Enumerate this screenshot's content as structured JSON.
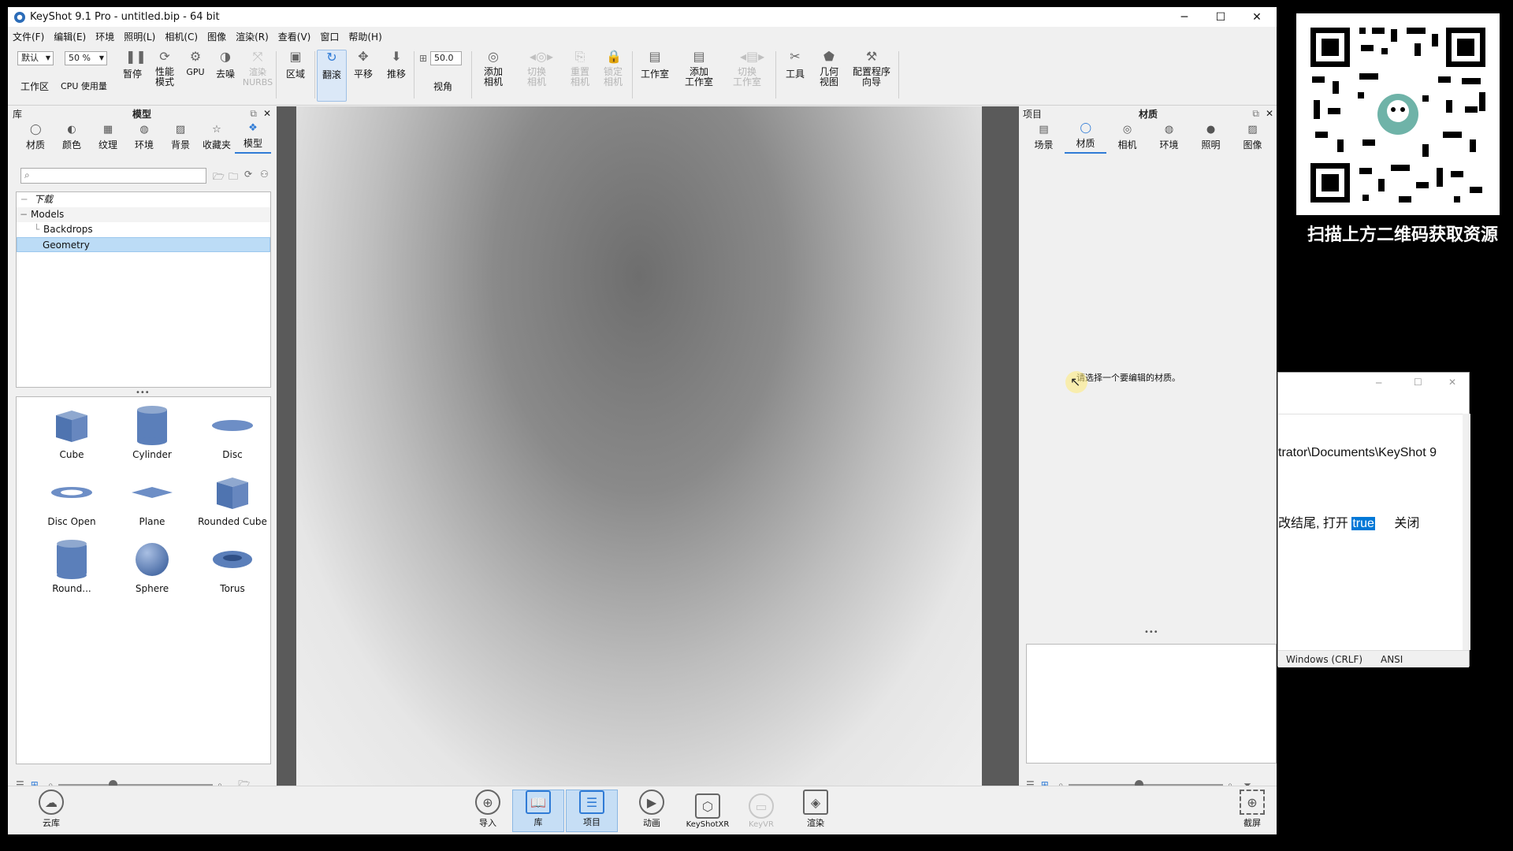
{
  "window": {
    "title": "KeyShot 9.1 Pro  - untitled.bip  - 64 bit",
    "minimize": "─",
    "maximize": "☐",
    "close": "✕"
  },
  "menu": [
    "文件(F)",
    "编辑(E)",
    "环境",
    "照明(L)",
    "相机(C)",
    "图像",
    "渲染(R)",
    "查看(V)",
    "窗口",
    "帮助(H)"
  ],
  "toolbar": {
    "workspace_select": "默认",
    "workspace_label": "工作区",
    "cpu_percent": "50 %",
    "cpu_label": "CPU 使用量",
    "pause": "暂停",
    "perf_mode": "性能\n模式",
    "gpu": "GPU",
    "denoise": "去噪",
    "render_nurbs": "渲染\nNURBS",
    "region": "区域",
    "tumble": "翻滚",
    "pan": "平移",
    "dolly": "推移",
    "fov_value": "50.0",
    "fov_label": "视角",
    "add_camera": "添加\n相机",
    "switch_camera": "切换\n相机",
    "reset_camera": "重置\n相机",
    "lock_camera": "锁定\n相机",
    "studio": "工作室",
    "add_studio": "添加\n工作室",
    "switch_studio": "切换\n工作室",
    "tools": "工具",
    "geometry_view": "几何\n视图",
    "config_wizard": "配置程序\n向导"
  },
  "library": {
    "panel_label": "库",
    "panel_title": "模型",
    "tabs": [
      "材质",
      "颜色",
      "纹理",
      "环境",
      "背景",
      "收藏夹",
      "模型"
    ],
    "active_tab": "模型",
    "search_placeholder": "",
    "tree": [
      "下载",
      "Models",
      "Backdrops",
      "Geometry"
    ],
    "selected": "Geometry",
    "thumbs": [
      "Cube",
      "Cylinder",
      "Disc",
      "Disc Open",
      "Plane",
      "Rounded Cube",
      "Round...",
      "Sphere",
      "Torus"
    ]
  },
  "project": {
    "panel_label": "项目",
    "panel_title": "材质",
    "tabs": [
      "场景",
      "材质",
      "相机",
      "环境",
      "照明",
      "图像"
    ],
    "active_tab": "材质",
    "message": "请选择一个要编辑的材质。"
  },
  "bottom": {
    "cloud": "云库",
    "import": "导入",
    "library": "库",
    "project": "项目",
    "animation": "动画",
    "keyshotxr": "KeyShotXR",
    "keyvr": "KeyVR",
    "render": "渲染",
    "screenshot": "截屏"
  },
  "qr": {
    "caption": "扫描上方二维码获取资源"
  },
  "notepad": {
    "path": "trator\\Documents\\KeyShot 9",
    "line2_prefix": "改结尾, 打开",
    "line2_selected": "true",
    "line2_suffix": "关闭",
    "encoding_eol": "Windows (CRLF)",
    "encoding": "ANSI"
  },
  "colors": {
    "accent": "#2f7bd6",
    "selection": "#bcdcf6"
  }
}
